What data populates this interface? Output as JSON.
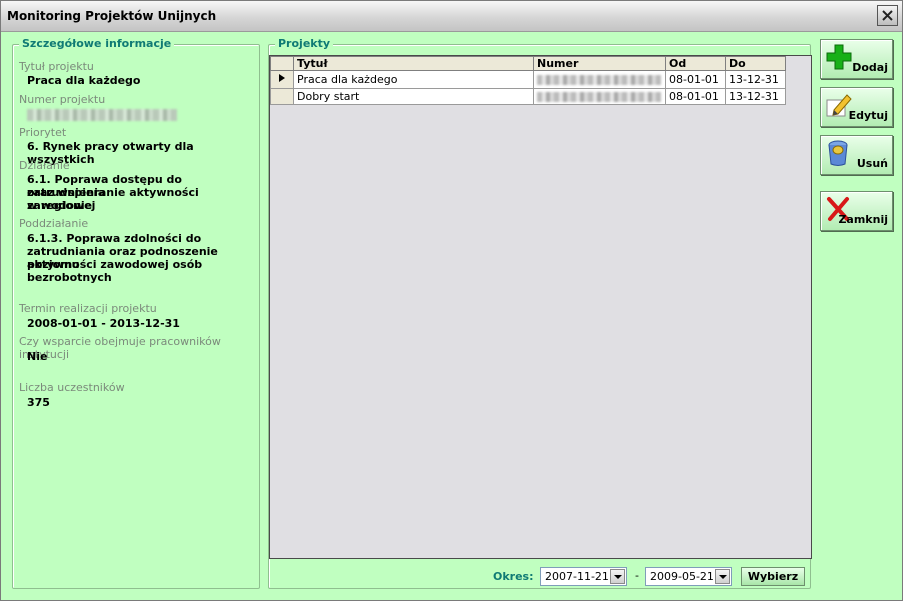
{
  "window": {
    "title": "Monitoring Projektów Unijnych"
  },
  "details": {
    "legend": "Szczegółowe informacje",
    "fields": [
      {
        "label": "Tytuł projektu",
        "value": "Praca dla każdego"
      },
      {
        "label": "Numer projektu"
      },
      {
        "label": "Priorytet",
        "value": "6. Rynek pracy otwarty dla wszystkich"
      },
      {
        "label": "Działanie",
        "value_lines": [
          "6.1. Poprawa dostępu do zatrudnienia",
          "oraz wspieranie aktywności zawodowej",
          "w regionie"
        ]
      },
      {
        "label": "Poddziałanie",
        "value_lines": [
          "6.1.3. Poprawa zdolności do",
          "zatrudniania oraz podnoszenie poziomu",
          "aktywności zawodowej osób",
          "bezrobotnych"
        ]
      },
      {
        "label": "Termin realizacji projektu",
        "value": "2008-01-01 - 2013-12-31"
      },
      {
        "label": "Czy wsparcie obejmuje pracowników instytucji",
        "value": "Nie"
      },
      {
        "label": "Liczba uczestników",
        "value": "375"
      }
    ]
  },
  "projects": {
    "legend": "Projekty",
    "columns": [
      "Tytuł",
      "Numer",
      "Od",
      "Do"
    ],
    "rows": [
      {
        "tytul": "Praca dla każdego",
        "od": "08-01-01",
        "do": "13-12-31",
        "current": true
      },
      {
        "tytul": "Dobry start",
        "od": "08-01-01",
        "do": "13-12-31",
        "current": false
      }
    ],
    "okres_label": "Okres:",
    "date_from": "2007-11-21",
    "dash": "-",
    "date_to": "2009-05-21",
    "wybierz": "Wybierz"
  },
  "buttons": {
    "dodaj": "Dodaj",
    "edytuj": "Edytuj",
    "usun": "Usuń",
    "zamknij": "Zamknij"
  },
  "icons": {
    "add": "plus-icon",
    "edit": "pencil-icon",
    "delete": "trash-icon",
    "close": "x-icon"
  }
}
